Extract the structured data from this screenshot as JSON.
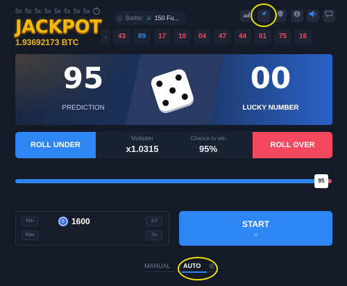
{
  "top": {
    "multipliers": [
      "5x",
      "5x",
      "5x",
      "5x",
      "5x",
      "5x",
      "5x",
      "5x"
    ],
    "help_glyph": "?"
  },
  "jackpot": {
    "title": "JACKPOT",
    "value": "1.93692173 BTC"
  },
  "battle": {
    "label": "Battle:",
    "value": "150 Fu..."
  },
  "toolbar_icons": [
    "chart-icon",
    "rocket-icon",
    "shield-icon",
    "help-icon",
    "sound-icon",
    "chat-icon"
  ],
  "history": {
    "arrow": "‹",
    "values": [
      {
        "v": "43",
        "color": "#f2495f"
      },
      {
        "v": "89",
        "color": "#2e86f5"
      },
      {
        "v": "17",
        "color": "#f2495f"
      },
      {
        "v": "10",
        "color": "#f2495f"
      },
      {
        "v": "04",
        "color": "#f2495f"
      },
      {
        "v": "47",
        "color": "#f2495f"
      },
      {
        "v": "44",
        "color": "#f2495f"
      },
      {
        "v": "01",
        "color": "#f2495f"
      },
      {
        "v": "75",
        "color": "#f2495f"
      },
      {
        "v": "16",
        "color": "#f2495f"
      }
    ]
  },
  "result": {
    "prediction": "95",
    "prediction_label": "PREDICTION",
    "lucky_number": "00",
    "lucky_label": "LUCKY NUMBER",
    "dice_face": 5
  },
  "roll": {
    "under_label": "ROLL UNDER",
    "over_label": "ROLL OVER",
    "multiplier_label": "Multiplier",
    "multiplier_value": "x1.0315",
    "chance_label": "Chance to win",
    "chance_value": "95%"
  },
  "slider": {
    "value": "95"
  },
  "bet": {
    "min_label": "Min",
    "max_label": "Max",
    "half_label": "1/2",
    "double_label": "2x",
    "amount": "1600",
    "coin_symbol": "◎"
  },
  "start": {
    "label": "START",
    "sub": "="
  },
  "mode_tabs": {
    "manual": "MANUAL",
    "auto": "AUTO",
    "info": "i"
  },
  "colors": {
    "accent_blue": "#2e86f5",
    "accent_red": "#f2495f",
    "jackpot_gold": "#f2b90c",
    "annotation_yellow": "#f2e20a"
  }
}
